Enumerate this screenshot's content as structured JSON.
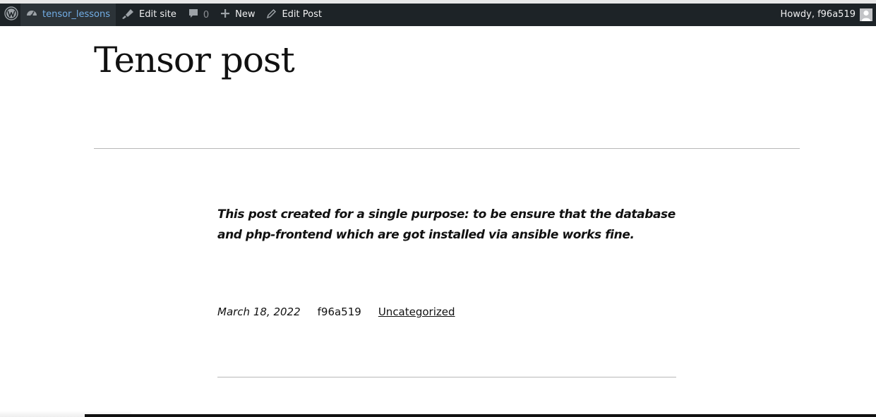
{
  "adminbar": {
    "site_name": "tensor_lessons",
    "edit_site": "Edit site",
    "comments_count": "0",
    "new_label": "New",
    "edit_post": "Edit Post",
    "howdy": "Howdy, f96a519"
  },
  "site": {
    "title": "Tensor post"
  },
  "post": {
    "content": "This post created for a single purpose: to be ensure that the database and php-frontend which are got installed via ansible works fine.",
    "date": "March 18, 2022",
    "author": "f96a519",
    "category": "Uncategorized"
  },
  "colors": {
    "adminbar_bg": "#1d2327",
    "site_link": "#72aee6",
    "text": "#111111"
  },
  "icons": [
    "wordpress-logo-icon",
    "dashboard-icon",
    "brush-icon",
    "comment-icon",
    "plus-icon",
    "pencil-icon",
    "avatar-icon"
  ]
}
